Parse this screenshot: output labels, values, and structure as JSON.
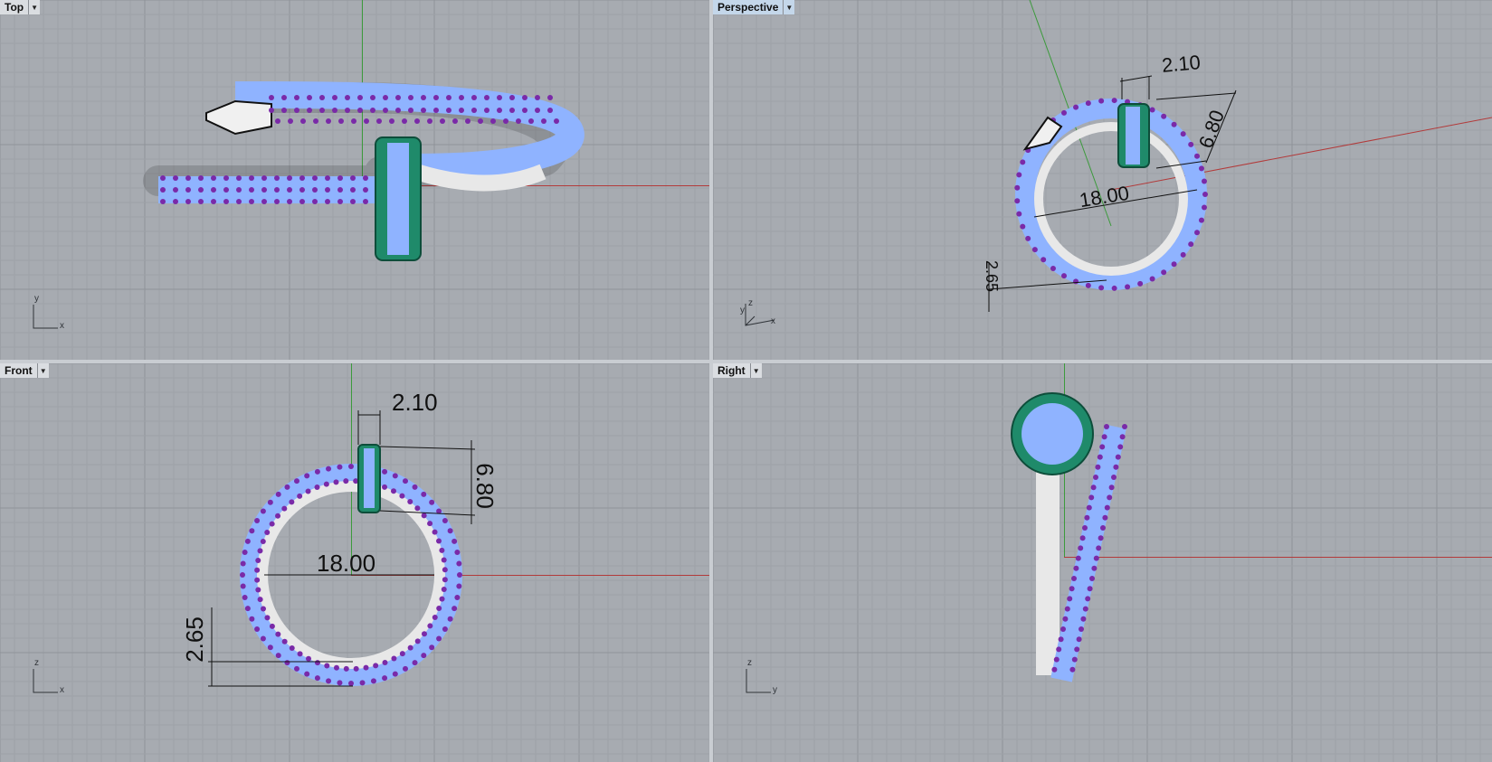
{
  "viewports": {
    "top": {
      "label": "Top",
      "axis_a": "y",
      "axis_b": "x"
    },
    "perspective": {
      "label": "Perspective",
      "axis_a": "z",
      "axis_b": "x",
      "axis_c": "y",
      "dims": {
        "width": "2.10",
        "height": "6.80",
        "diameter": "18.00",
        "thickness": "2.65"
      }
    },
    "front": {
      "label": "Front",
      "axis_a": "z",
      "axis_b": "x",
      "dims": {
        "width": "2.10",
        "height": "6.80",
        "diameter": "18.00",
        "thickness": "2.65"
      }
    },
    "right": {
      "label": "Right",
      "axis_a": "z",
      "axis_b": "y"
    }
  },
  "icons": {
    "menu": "chevron-down-icon"
  },
  "colors": {
    "viewport_bg": "#a7abb1",
    "grid_minor": "#9ea2a8",
    "grid_major": "#8f9399",
    "x_axis": "#b23a3a",
    "y_axis": "#3c9a3c",
    "band": "#1f8a6a",
    "gem": "#8fb3ff",
    "prong": "#7a2aa8",
    "active_tab": "#c4d7ea"
  }
}
